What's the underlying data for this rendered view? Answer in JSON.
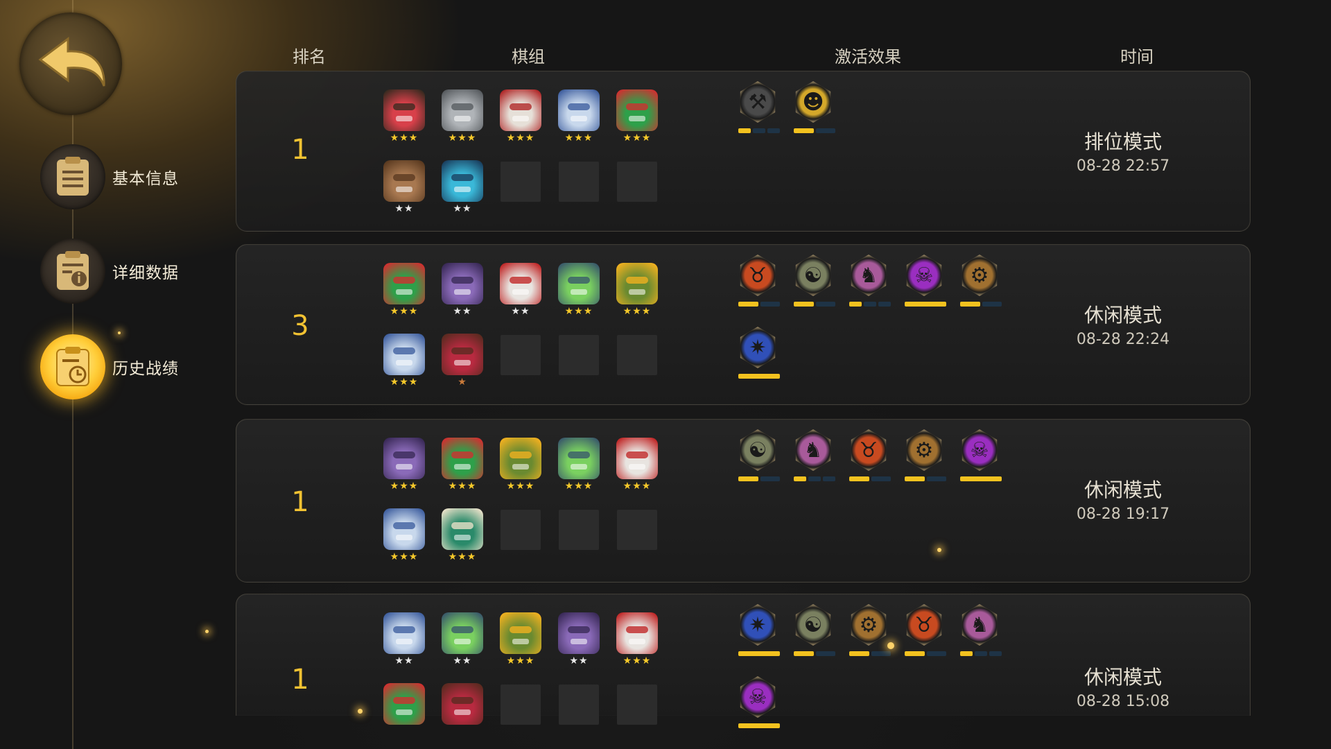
{
  "nav": {
    "items": [
      {
        "key": "basic",
        "label": "基本信息",
        "icon": "clipboard-icon",
        "active": false
      },
      {
        "key": "detail",
        "label": "详细数据",
        "icon": "info-doc-icon",
        "active": false
      },
      {
        "key": "history",
        "label": "历史战绩",
        "icon": "history-clock-icon",
        "active": true
      }
    ]
  },
  "headers": {
    "rank": "排名",
    "lineup": "棋组",
    "traits": "激活效果",
    "time": "时间"
  },
  "colors": {
    "accent": "#f2c232",
    "bar_on": "#f3c21f",
    "bar_off": "#1e3346"
  },
  "matches": [
    {
      "rank": "1",
      "mode": "排位模式",
      "time": "08-28 22:57",
      "champions": [
        {
          "name": "red-warrior",
          "stars": 3
        },
        {
          "name": "grey-knight",
          "stars": 3
        },
        {
          "name": "white-beard",
          "stars": 3
        },
        {
          "name": "blue-robot",
          "stars": 3
        },
        {
          "name": "green-goggles",
          "stars": 3
        },
        {
          "name": "brown-ogre",
          "stars": 2
        },
        {
          "name": "cyan-mech",
          "stars": 2
        }
      ],
      "traits": [
        {
          "icon": "axe-icon",
          "tier": 1,
          "max": 3,
          "color": "#4a4a4a"
        },
        {
          "icon": "yellow-dwarf-icon",
          "tier": 1,
          "max": 2,
          "color": "#d4a82a"
        }
      ]
    },
    {
      "rank": "3",
      "mode": "休闲模式",
      "time": "08-28 22:24",
      "champions": [
        {
          "name": "green-goggles",
          "stars": 3
        },
        {
          "name": "purple-cat",
          "stars": 2
        },
        {
          "name": "white-mask",
          "stars": 2
        },
        {
          "name": "green-frog",
          "stars": 3
        },
        {
          "name": "yellow-goggles",
          "stars": 3
        },
        {
          "name": "blue-robot",
          "stars": 3
        },
        {
          "name": "red-ogre",
          "stars": 1
        }
      ],
      "traits": [
        {
          "icon": "demon-icon",
          "tier": 1,
          "max": 2,
          "color": "#c84a20"
        },
        {
          "icon": "beast-icon",
          "tier": 1,
          "max": 2,
          "color": "#7a8060"
        },
        {
          "icon": "knight-icon",
          "tier": 1,
          "max": 3,
          "color": "#a85a9a"
        },
        {
          "icon": "undead-icon",
          "tier": 1,
          "max": 1,
          "color": "#9a2ec0"
        },
        {
          "icon": "gear-icon",
          "tier": 1,
          "max": 2,
          "color": "#a07030"
        },
        {
          "icon": "element-icon",
          "tier": 1,
          "max": 1,
          "color": "#3050b8"
        }
      ]
    },
    {
      "rank": "1",
      "mode": "休闲模式",
      "time": "08-28 19:17",
      "champions": [
        {
          "name": "purple-cat",
          "stars": 3
        },
        {
          "name": "green-goggles",
          "stars": 3
        },
        {
          "name": "yellow-goggles",
          "stars": 3
        },
        {
          "name": "green-frog",
          "stars": 3
        },
        {
          "name": "white-mask",
          "stars": 3
        },
        {
          "name": "blue-robot",
          "stars": 3
        },
        {
          "name": "green-troll",
          "stars": 3
        }
      ],
      "traits": [
        {
          "icon": "beast-icon",
          "tier": 1,
          "max": 2,
          "color": "#7a8060"
        },
        {
          "icon": "knight-icon",
          "tier": 1,
          "max": 3,
          "color": "#a85a9a"
        },
        {
          "icon": "demon-icon",
          "tier": 1,
          "max": 2,
          "color": "#c84a20"
        },
        {
          "icon": "gear-icon",
          "tier": 1,
          "max": 2,
          "color": "#a07030"
        },
        {
          "icon": "undead-icon",
          "tier": 1,
          "max": 1,
          "color": "#9a2ec0"
        }
      ]
    },
    {
      "rank": "1",
      "mode": "休闲模式",
      "time": "08-28 15:08",
      "champions": [
        {
          "name": "blue-robot",
          "stars": 2
        },
        {
          "name": "green-frog",
          "stars": 2
        },
        {
          "name": "yellow-goggles",
          "stars": 3
        },
        {
          "name": "purple-cat",
          "stars": 2
        },
        {
          "name": "white-mask",
          "stars": 3
        },
        {
          "name": "green-goggles",
          "stars": 0
        },
        {
          "name": "red-ogre",
          "stars": 0
        }
      ],
      "traits": [
        {
          "icon": "element-icon",
          "tier": 1,
          "max": 1,
          "color": "#3050b8"
        },
        {
          "icon": "beast-icon",
          "tier": 1,
          "max": 2,
          "color": "#7a8060"
        },
        {
          "icon": "gear-icon",
          "tier": 1,
          "max": 2,
          "color": "#a07030"
        },
        {
          "icon": "demon-icon",
          "tier": 1,
          "max": 2,
          "color": "#c84a20"
        },
        {
          "icon": "knight-icon",
          "tier": 1,
          "max": 3,
          "color": "#a85a9a"
        },
        {
          "icon": "undead-icon",
          "tier": 1,
          "max": 1,
          "color": "#9a2ec0"
        }
      ]
    }
  ]
}
